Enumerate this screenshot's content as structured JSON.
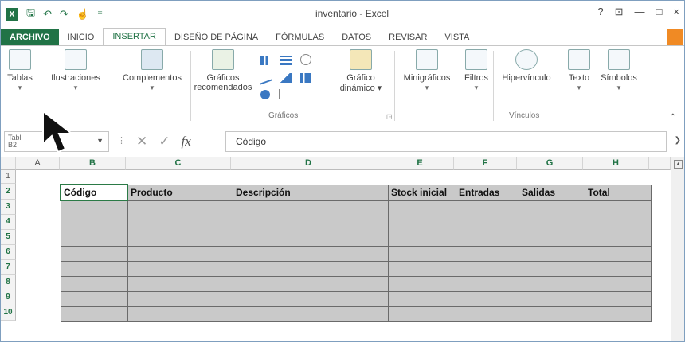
{
  "title": "inventario - Excel",
  "window": {
    "help": "?",
    "restore": "⊡",
    "minimize": "—",
    "maximize": "□",
    "close": "×"
  },
  "qat": {
    "logo": "X",
    "save": "🖫",
    "undo": "↶",
    "redo": "↷",
    "touch": "☝",
    "customize": "⁼"
  },
  "tabs": [
    "ARCHIVO",
    "INICIO",
    "INSERTAR",
    "DISEÑO DE PÁGINA",
    "FÓRMULAS",
    "DATOS",
    "REVISAR",
    "VISTA"
  ],
  "ribbon": {
    "tablas": "Tablas",
    "ilustraciones": "Ilustraciones",
    "complementos": "Complementos",
    "graficos_rec_1": "Gráficos",
    "graficos_rec_2": "recomendados",
    "grafico_din_1": "Gráfico",
    "grafico_din_2": "dinámico ▾",
    "group_graficos": "Gráficos",
    "minigraficos": "Minigráficos",
    "filtros": "Filtros",
    "hipervinculo": "Hipervínculo",
    "group_vinculos": "Vínculos",
    "texto": "Texto",
    "simbolos": "Símbolos"
  },
  "formula_bar": {
    "namebox_partial": "Tabl",
    "namebox_partial2": "B2",
    "fx": "fx",
    "content": "Código"
  },
  "columns": [
    "A",
    "B",
    "C",
    "D",
    "E",
    "F",
    "G",
    "H"
  ],
  "rows": [
    "1",
    "2",
    "3",
    "4",
    "5",
    "6",
    "7",
    "8",
    "9",
    "10"
  ],
  "table": {
    "headers": [
      "Código",
      "Producto",
      "Descripción",
      "Stock inicial",
      "Entradas",
      "Salidas",
      "Total"
    ],
    "empty_rows": 8
  },
  "accent": "#217346",
  "cell_fill": "#c9c9c9"
}
